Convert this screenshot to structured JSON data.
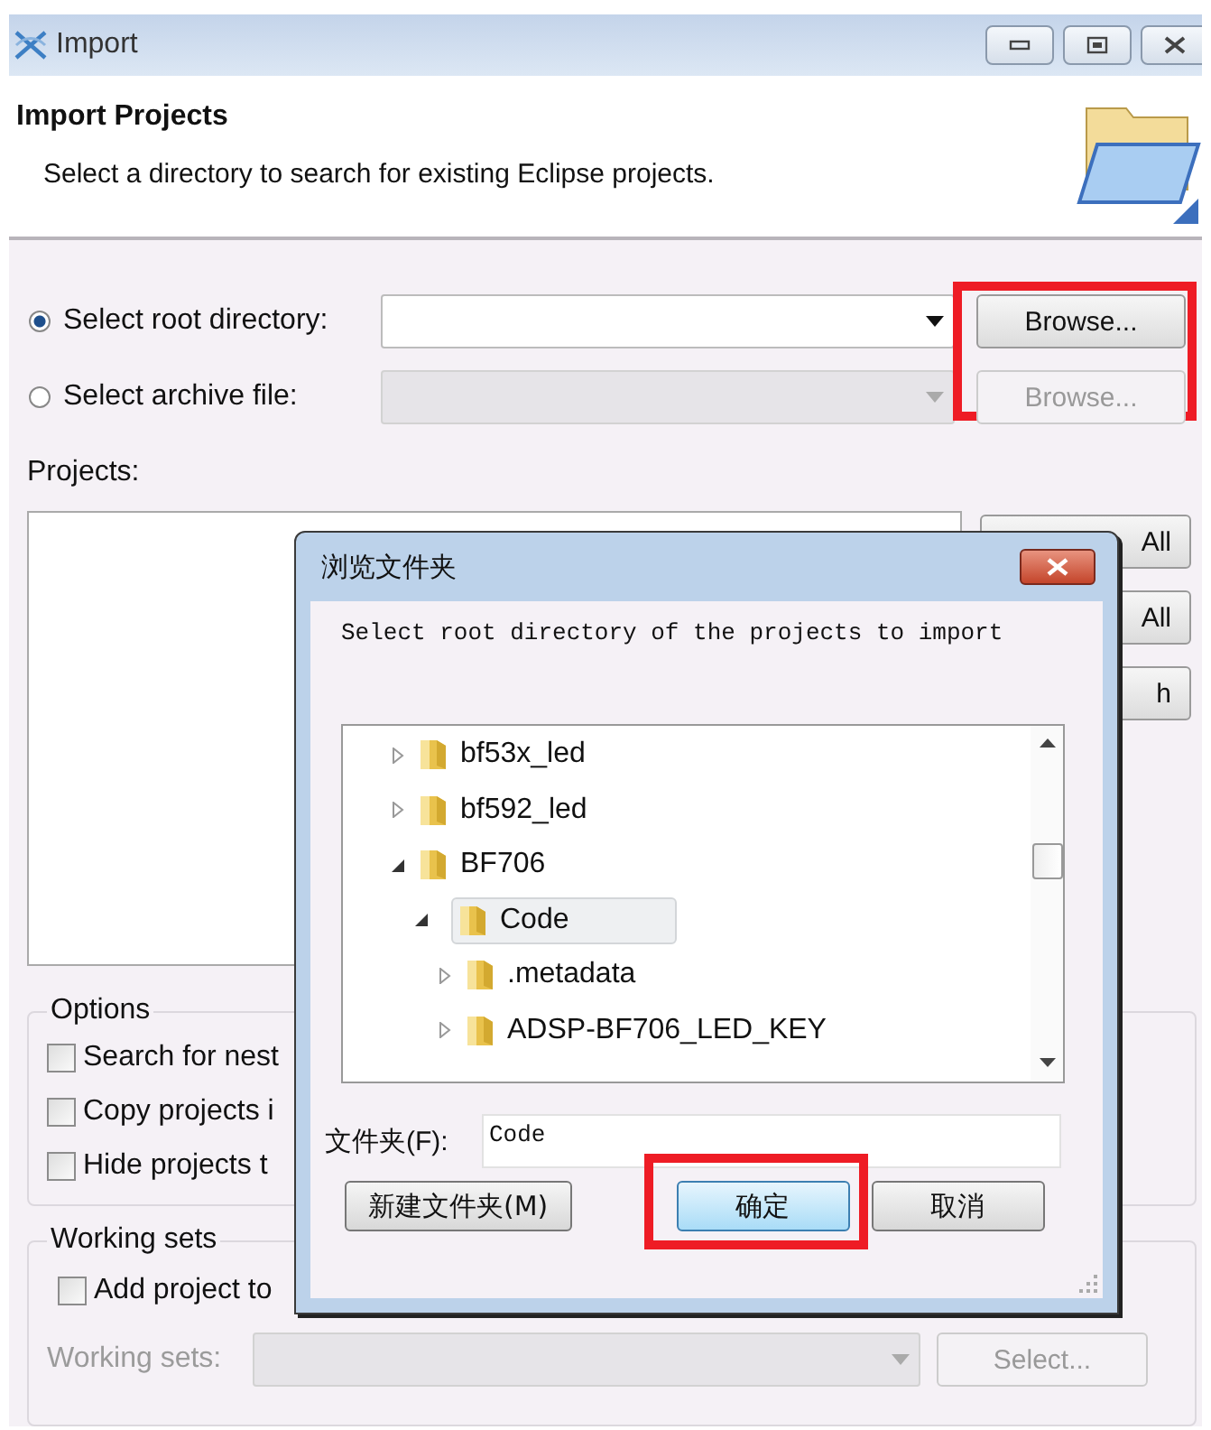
{
  "window": {
    "title": "Import"
  },
  "header": {
    "title": "Import Projects",
    "description": "Select a directory to search for existing Eclipse projects."
  },
  "sources": [
    {
      "label": "Select root directory:",
      "selected": true,
      "disabled": false,
      "button": "Browse...",
      "highlighted": true
    },
    {
      "label": "Select archive file:",
      "selected": false,
      "disabled": true,
      "button": "Browse...",
      "highlighted": false
    }
  ],
  "projects": {
    "label": "Projects:",
    "buttons": [
      "All",
      "All",
      "h"
    ]
  },
  "options": {
    "title": "Options",
    "items": [
      {
        "label": "Search for nest",
        "checked": false
      },
      {
        "label": "Copy projects i",
        "checked": false
      },
      {
        "label": "Hide projects t",
        "checked": false
      }
    ]
  },
  "working_sets": {
    "title": "Working sets",
    "add_label": "Add project to",
    "checked": false,
    "field_label": "Working sets:",
    "button": "Select...",
    "disabled": true
  },
  "dialog": {
    "title": "浏览文件夹",
    "prompt": "Select root directory of the projects to import",
    "tree": [
      {
        "label": "bf53x_led",
        "expanded": false,
        "selected": false
      },
      {
        "label": "bf592_led",
        "expanded": false,
        "selected": false
      },
      {
        "label": "BF706",
        "expanded": true,
        "selected": false,
        "children": [
          {
            "label": "Code",
            "expanded": true,
            "selected": true,
            "children": [
              {
                "label": ".metadata",
                "expanded": false,
                "selected": false
              },
              {
                "label": "ADSP-BF706_LED_KEY",
                "expanded": false,
                "selected": false
              }
            ]
          }
        ]
      }
    ],
    "folder_label": "文件夹(F):",
    "folder_value": "Code",
    "buttons": [
      {
        "label": "新建文件夹(M)",
        "kind": "normal",
        "highlighted": false
      },
      {
        "label": "确定",
        "kind": "default",
        "highlighted": true
      },
      {
        "label": "取消",
        "kind": "normal",
        "highlighted": false
      }
    ]
  }
}
